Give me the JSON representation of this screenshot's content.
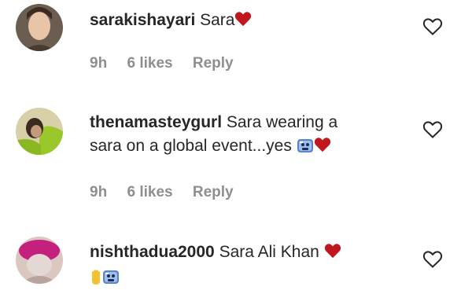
{
  "comments": [
    {
      "username": "sarakishayari",
      "text": "Sara",
      "time": "9h",
      "likes": "6 likes",
      "reply": "Reply"
    },
    {
      "username": "thenamasteygurl",
      "text_line1": "Sara wearing a",
      "text_line2": "sara on a global event...yes",
      "time": "9h",
      "likes": "6 likes",
      "reply": "Reply"
    },
    {
      "username": "nishthadua2000",
      "text": "Sara Ali Khan"
    }
  ],
  "colors": {
    "heart": "#c0161d",
    "meta_text": "#8e8e8e"
  }
}
